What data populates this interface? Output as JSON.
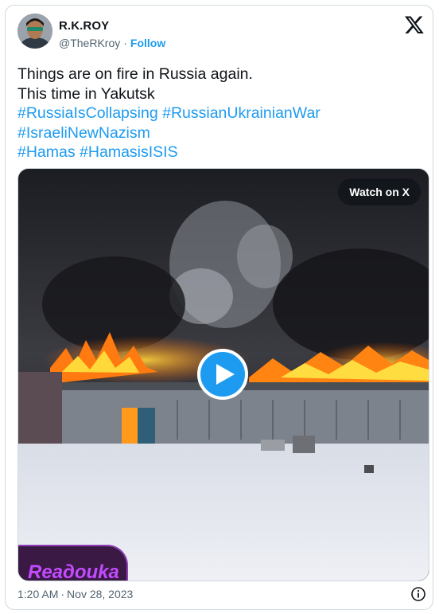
{
  "author": {
    "name": "R.K.ROY",
    "handle": "@TheRKroy",
    "separator": "·",
    "follow_label": "Follow"
  },
  "tweet": {
    "line1": "Things are on fire in Russia again.",
    "line2": "This time in Yakutsk",
    "hashtags_line1": [
      "#RussiaIsCollapsing",
      "#RussianUkrainianWar"
    ],
    "hashtags_line2": [
      "#IsraeliNewNazism"
    ],
    "hashtags_line3": [
      "#Hamas",
      "#HamasisISIS"
    ]
  },
  "media": {
    "watch_label": "Watch on X",
    "play_icon": "play-icon"
  },
  "footer": {
    "time": "1:20 AM",
    "separator": "·",
    "date": "Nov 28, 2023",
    "info_icon": "info-icon"
  },
  "colors": {
    "link": "#1d9bf0",
    "secondary_text": "#536471",
    "primary_text": "#0f1419",
    "border": "#cfd9de"
  }
}
